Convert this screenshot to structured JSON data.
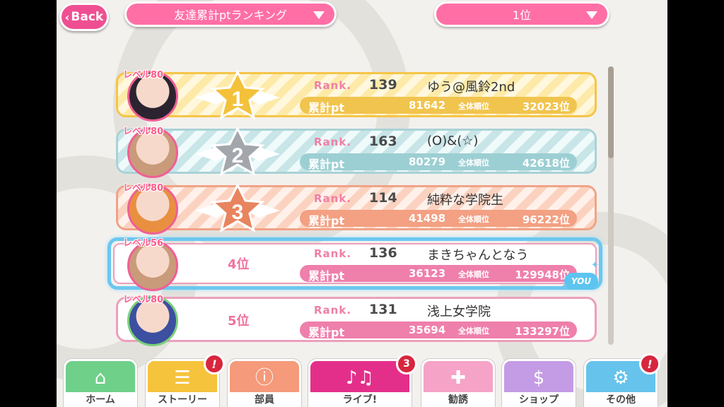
{
  "header": {
    "back_label": "Back",
    "sort_dropdown": "友達累計ptランキング",
    "rank_dropdown": "1位"
  },
  "labels": {
    "rank": "Rank.",
    "points": "累計pt",
    "overall": "全体順位",
    "you": "YOU"
  },
  "rows": [
    {
      "level": "レベル80",
      "medal": "1",
      "rank": "139",
      "name": "ゆう@風鈴2nd",
      "points": "81642",
      "overall": "32023位"
    },
    {
      "level": "レベル80",
      "medal": "2",
      "rank": "163",
      "name": "(O)&(☆)",
      "points": "80279",
      "overall": "42618位"
    },
    {
      "level": "レベル80",
      "medal": "3",
      "rank": "114",
      "name": "純粋な学院生",
      "points": "41498",
      "overall": "96222位"
    },
    {
      "level": "レベル56",
      "place": "4位",
      "rank": "136",
      "name": "まきちゃんとなう",
      "points": "36123",
      "overall": "129948位"
    },
    {
      "level": "レベル80",
      "place": "5位",
      "rank": "131",
      "name": "浅上女学院",
      "points": "35694",
      "overall": "133297位"
    }
  ],
  "nav": {
    "home": "ホーム",
    "story": "ストーリー",
    "club": "部員",
    "live": "ライブ!",
    "scout": "勧誘",
    "shop": "ショップ",
    "other": "その他",
    "live_count": "3",
    "notice_mark": "!"
  },
  "colors": {
    "accent_pink": "#ef4f92",
    "gold": "#f1c44e",
    "silver": "#9ccfd3",
    "bronze": "#f3a083",
    "you_highlight": "#6cc7ef"
  }
}
